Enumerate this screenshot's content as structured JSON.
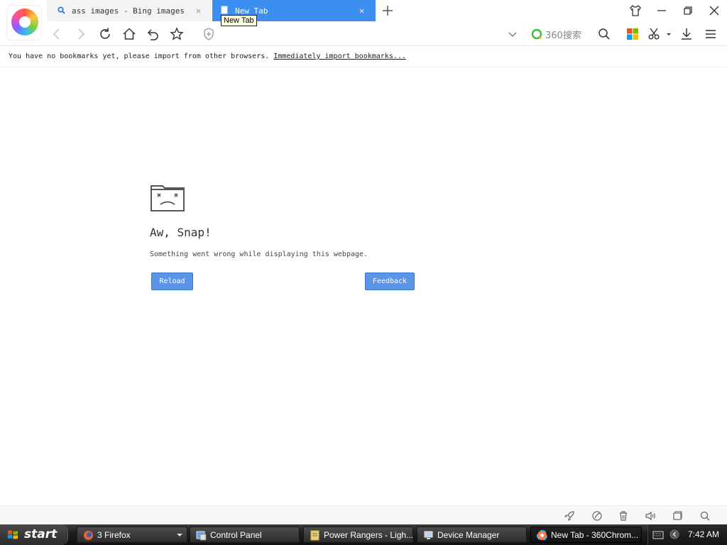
{
  "browser": {
    "tabs": [
      {
        "title": "ass images - Bing images",
        "active": false
      },
      {
        "title": "New Tab",
        "active": true
      }
    ],
    "tooltip": "New Tab",
    "search_engine_label": "360搜索",
    "bookmarks_message": "You have no bookmarks yet, please import from other browsers.",
    "import_link": "Immediately import bookmarks...",
    "accent_color": "#3c8ff0"
  },
  "error_page": {
    "title": "Aw, Snap!",
    "message": "Something went wrong while displaying this webpage.",
    "reload_label": "Reload",
    "feedback_label": "Feedback",
    "button_color": "#5a95e8"
  },
  "taskbar": {
    "start_label": "start",
    "tasks": [
      {
        "label": "3 Firefox",
        "icon": "firefox-icon",
        "grouped": true
      },
      {
        "label": "Control Panel",
        "icon": "control-panel-icon"
      },
      {
        "label": "Power Rangers - Ligh...",
        "icon": "document-icon"
      },
      {
        "label": "Device Manager",
        "icon": "device-manager-icon"
      },
      {
        "label": "New Tab - 360Chrom...",
        "icon": "360-browser-icon",
        "active": true
      }
    ],
    "clock": "7:42 AM"
  }
}
